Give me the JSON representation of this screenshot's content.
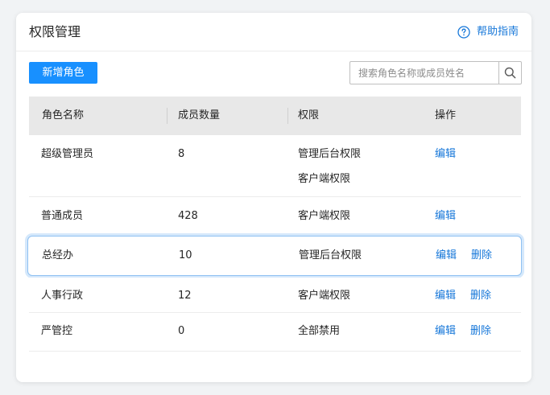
{
  "header": {
    "title": "权限管理",
    "help_label": "帮助指南"
  },
  "toolbar": {
    "add_label": "新增角色",
    "search_placeholder": "搜索角色名称或成员姓名"
  },
  "table": {
    "columns": [
      "角色名称",
      "成员数量",
      "权限",
      "操作"
    ],
    "rows": [
      {
        "name": "超级管理员",
        "count": "8",
        "perms": [
          "管理后台权限",
          "客户端权限"
        ],
        "actions": [
          "编辑"
        ]
      },
      {
        "name": "普通成员",
        "count": "428",
        "perms": [
          "客户端权限"
        ],
        "actions": [
          "编辑"
        ]
      },
      {
        "name": "总经办",
        "count": "10",
        "perms": [
          "管理后台权限"
        ],
        "actions": [
          "编辑",
          "删除"
        ]
      },
      {
        "name": "人事行政",
        "count": "12",
        "perms": [
          "客户端权限"
        ],
        "actions": [
          "编辑",
          "删除"
        ]
      },
      {
        "name": "严管控",
        "count": "0",
        "perms": [
          "全部禁用"
        ],
        "actions": [
          "编辑",
          "删除"
        ]
      }
    ]
  },
  "colors": {
    "accent": "#1890ff",
    "link": "#1677d9",
    "header_bg": "#e8e8e8",
    "highlight_border": "#8fc1f2"
  }
}
